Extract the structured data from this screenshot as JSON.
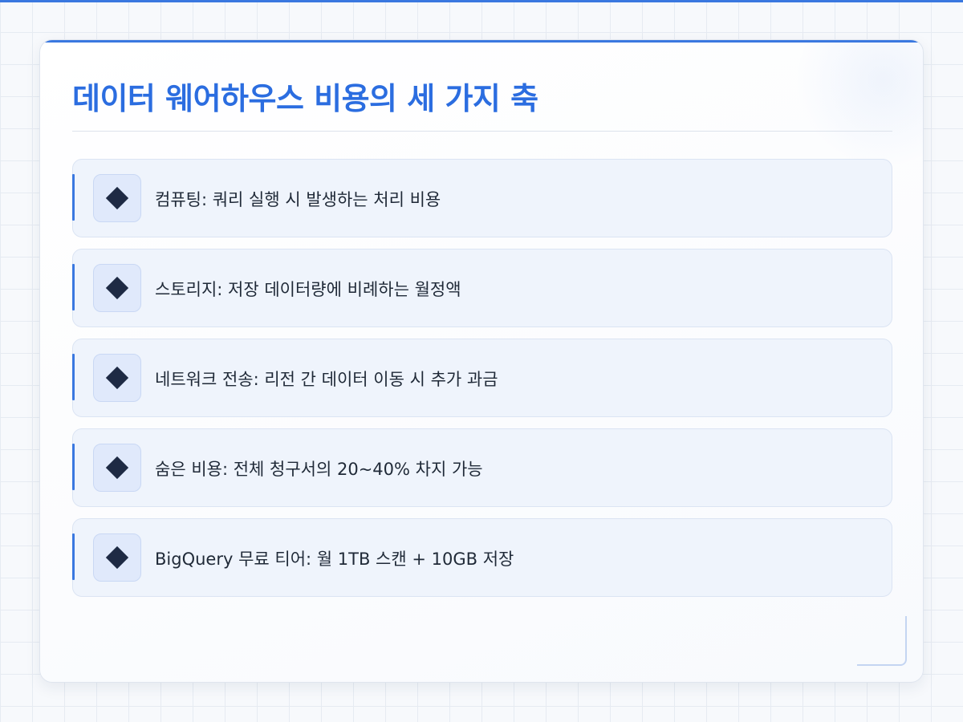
{
  "slide": {
    "title": "데이터 웨어하우스 비용의 세 가지 축",
    "items": [
      {
        "icon": "diamond-icon",
        "text": "컴퓨팅: 쿼리 실행 시 발생하는 처리 비용"
      },
      {
        "icon": "diamond-icon",
        "text": "스토리지: 저장 데이터량에 비례하는 월정액"
      },
      {
        "icon": "diamond-icon",
        "text": "네트워크 전송: 리전 간 데이터 이동 시 추가 과금"
      },
      {
        "icon": "diamond-icon",
        "text": "숨은 비용: 전체 청구서의 20~40% 차지 가능"
      },
      {
        "icon": "diamond-icon",
        "text": "BigQuery 무료 티어: 월 1TB 스캔 + 10GB 저장"
      }
    ]
  },
  "colors": {
    "accent": "#3a78e0",
    "title": "#2b6de0",
    "icon": "#1e2a44",
    "text": "#1f2937"
  }
}
